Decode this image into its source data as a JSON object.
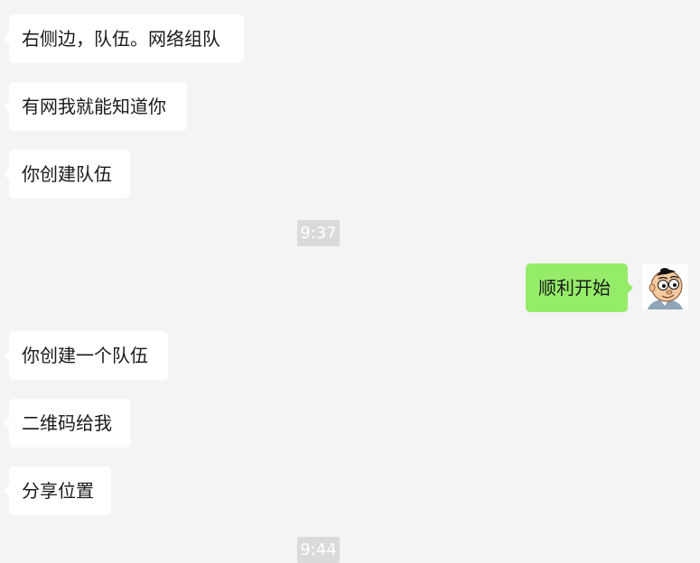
{
  "chat": {
    "messages_group_1": [
      {
        "text": "右侧边，队伍。网络组队"
      },
      {
        "text": "有网我就能知道你"
      },
      {
        "text": "你创建队伍"
      }
    ],
    "timestamp_1": "9:37",
    "sent_message": {
      "text": "顺利开始"
    },
    "messages_group_2": [
      {
        "text": "你创建一个队伍"
      },
      {
        "text": "二维码给我"
      },
      {
        "text": "分享位置"
      }
    ],
    "timestamp_2": "9:44"
  },
  "colors": {
    "background": "#f4f4f4",
    "incoming_bubble": "#ffffff",
    "outgoing_bubble": "#95ec69",
    "timestamp_bg": "#dadada",
    "text": "#1a1a1a"
  },
  "icons": {
    "avatar": "cartoon-face-avatar-icon"
  }
}
